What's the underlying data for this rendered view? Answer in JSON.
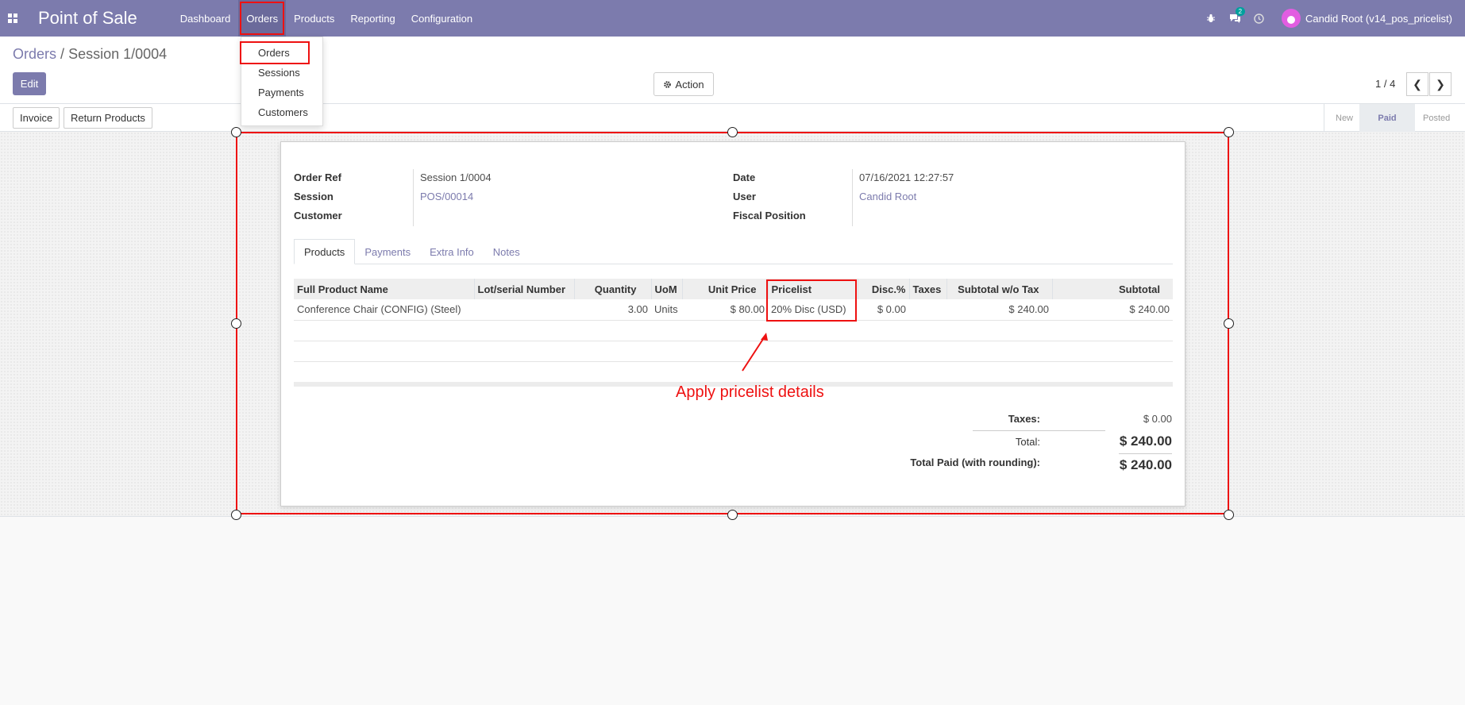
{
  "navbar": {
    "brand": "Point of Sale",
    "menu": [
      "Dashboard",
      "Orders",
      "Products",
      "Reporting",
      "Configuration"
    ],
    "chat_badge": "2",
    "user": "Candid Root (v14_pos_pricelist)"
  },
  "orders_menu": [
    "Orders",
    "Sessions",
    "Payments",
    "Customers"
  ],
  "breadcrumb": {
    "parent": "Orders",
    "separator": "/",
    "current": "Session 1/0004"
  },
  "buttons": {
    "edit": "Edit",
    "action": "Action",
    "invoice": "Invoice",
    "return_products": "Return Products"
  },
  "pager": {
    "value": "1 / 4"
  },
  "stages": [
    "New",
    "Paid",
    "Posted"
  ],
  "current_stage": "Paid",
  "form": {
    "order_ref_label": "Order Ref",
    "order_ref": "Session 1/0004",
    "session_label": "Session",
    "session": "POS/00014",
    "customer_label": "Customer",
    "customer": "",
    "date_label": "Date",
    "date": "07/16/2021 12:27:57",
    "user_label": "User",
    "user": "Candid Root",
    "fiscal_label": "Fiscal Position",
    "fiscal": ""
  },
  "tabs": [
    "Products",
    "Payments",
    "Extra Info",
    "Notes"
  ],
  "table": {
    "headers": [
      "Full Product Name",
      "Lot/serial Number",
      "Quantity",
      "UoM",
      "Unit Price",
      "Pricelist",
      "Disc.%",
      "Taxes",
      "Subtotal w/o Tax",
      "Subtotal"
    ],
    "rows": [
      [
        "Conference Chair (CONFIG) (Steel)",
        "",
        "3.00",
        "Units",
        "$ 80.00",
        "20% Disc (USD)",
        "$ 0.00",
        "",
        "$ 240.00",
        "$ 240.00"
      ]
    ]
  },
  "totals": {
    "taxes_label": "Taxes:",
    "taxes": "$ 0.00",
    "total_label": "Total:",
    "total": "$ 240.00",
    "paid_label": "Total Paid (with rounding):",
    "paid": "$ 240.00"
  },
  "annotation": "Apply pricelist details",
  "colors": {
    "brand": "#7c7bad",
    "highlight": "#e11111"
  }
}
